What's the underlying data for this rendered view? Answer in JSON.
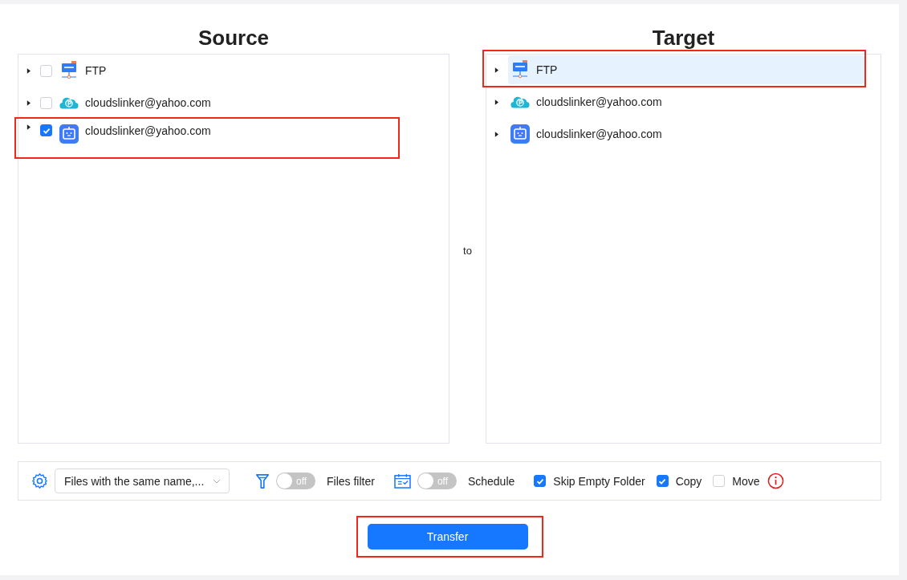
{
  "source": {
    "title": "Source",
    "items": [
      {
        "label": "FTP",
        "kind": "ftp",
        "checked": false,
        "highlighted": false
      },
      {
        "label": "cloudslinker@yahoo.com",
        "kind": "cloud",
        "checked": false,
        "highlighted": false
      },
      {
        "label": "cloudslinker@yahoo.com",
        "kind": "bot",
        "checked": true,
        "highlighted": true
      }
    ]
  },
  "connector": "to",
  "target": {
    "title": "Target",
    "items": [
      {
        "label": "FTP",
        "kind": "ftp",
        "selected": true,
        "highlighted": true
      },
      {
        "label": "cloudslinker@yahoo.com",
        "kind": "cloud",
        "selected": false,
        "highlighted": false
      },
      {
        "label": "cloudslinker@yahoo.com",
        "kind": "bot",
        "selected": false,
        "highlighted": false
      }
    ]
  },
  "options": {
    "conflict": {
      "value": "Files with the same name,..."
    },
    "filter": {
      "label": "Files filter",
      "switch_text": "off",
      "on": false
    },
    "schedule": {
      "label": "Schedule",
      "switch_text": "off",
      "on": false
    },
    "checks": [
      {
        "label": "Skip Empty Folder",
        "checked": true
      },
      {
        "label": "Copy",
        "checked": true
      },
      {
        "label": "Move",
        "checked": false
      }
    ]
  },
  "transfer": {
    "label": "Transfer",
    "highlighted": true
  }
}
